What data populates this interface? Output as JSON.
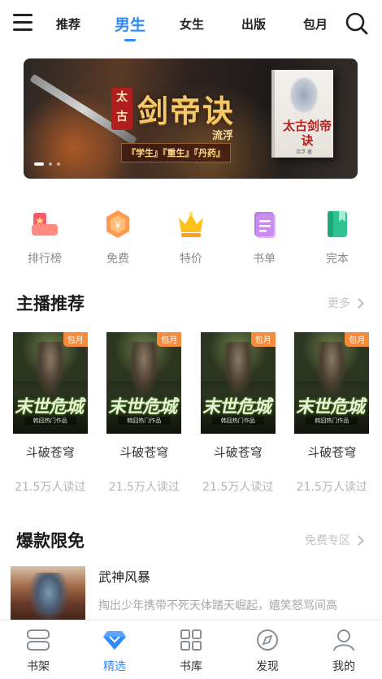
{
  "colors": {
    "accent": "#2f8bf5",
    "badge": "#f58c3c",
    "muted": "#b4b4b4"
  },
  "top_nav": {
    "tabs": [
      {
        "label": "推荐",
        "active": false
      },
      {
        "label": "男生",
        "active": true
      },
      {
        "label": "女生",
        "active": false
      },
      {
        "label": "出版",
        "active": false
      },
      {
        "label": "包月",
        "active": false
      }
    ]
  },
  "banner": {
    "seal_text": "太古",
    "title": "剑帝诀",
    "author": "流浮",
    "tags": "『学生』『重生』『丹药』",
    "cover_title": "太古剑帝诀",
    "cover_author": "流浮 著",
    "slide_count": 3,
    "active_slide": 1
  },
  "categories": [
    {
      "label": "排行榜",
      "icon": "ranking-icon"
    },
    {
      "label": "免费",
      "icon": "free-icon"
    },
    {
      "label": "特价",
      "icon": "crown-icon"
    },
    {
      "label": "书单",
      "icon": "booklist-icon"
    },
    {
      "label": "完本",
      "icon": "completed-book-icon"
    }
  ],
  "anchor_section": {
    "title": "主播推荐",
    "more_label": "更多",
    "books": [
      {
        "title": "斗破苍穹",
        "reads": "21.5万人读过",
        "badge": "包月",
        "cover_title": "末世危城",
        "cover_sub": "韩囧热门作品"
      },
      {
        "title": "斗破苍穹",
        "reads": "21.5万人读过",
        "badge": "包月",
        "cover_title": "末世危城",
        "cover_sub": "韩囧热门作品"
      },
      {
        "title": "斗破苍穹",
        "reads": "21.5万人读过",
        "badge": "包月",
        "cover_title": "末世危城",
        "cover_sub": "韩囧热门作品"
      },
      {
        "title": "斗破苍穹",
        "reads": "21.5万人读过",
        "badge": "包月",
        "cover_title": "末世危城",
        "cover_sub": "韩囧热门作品"
      }
    ]
  },
  "free_section": {
    "title": "爆款限免",
    "more_label": "免费专区",
    "items": [
      {
        "title": "武神风暴",
        "desc": "掏出少年携带不死天体踏天崛起，嬉笑怒骂间高"
      }
    ]
  },
  "bottom_tabs": [
    {
      "label": "书架",
      "icon": "bookshelf-icon",
      "active": false
    },
    {
      "label": "精选",
      "icon": "diamond-icon",
      "active": true
    },
    {
      "label": "书库",
      "icon": "grid-icon",
      "active": false
    },
    {
      "label": "发现",
      "icon": "compass-icon",
      "active": false
    },
    {
      "label": "我的",
      "icon": "user-icon",
      "active": false
    }
  ]
}
